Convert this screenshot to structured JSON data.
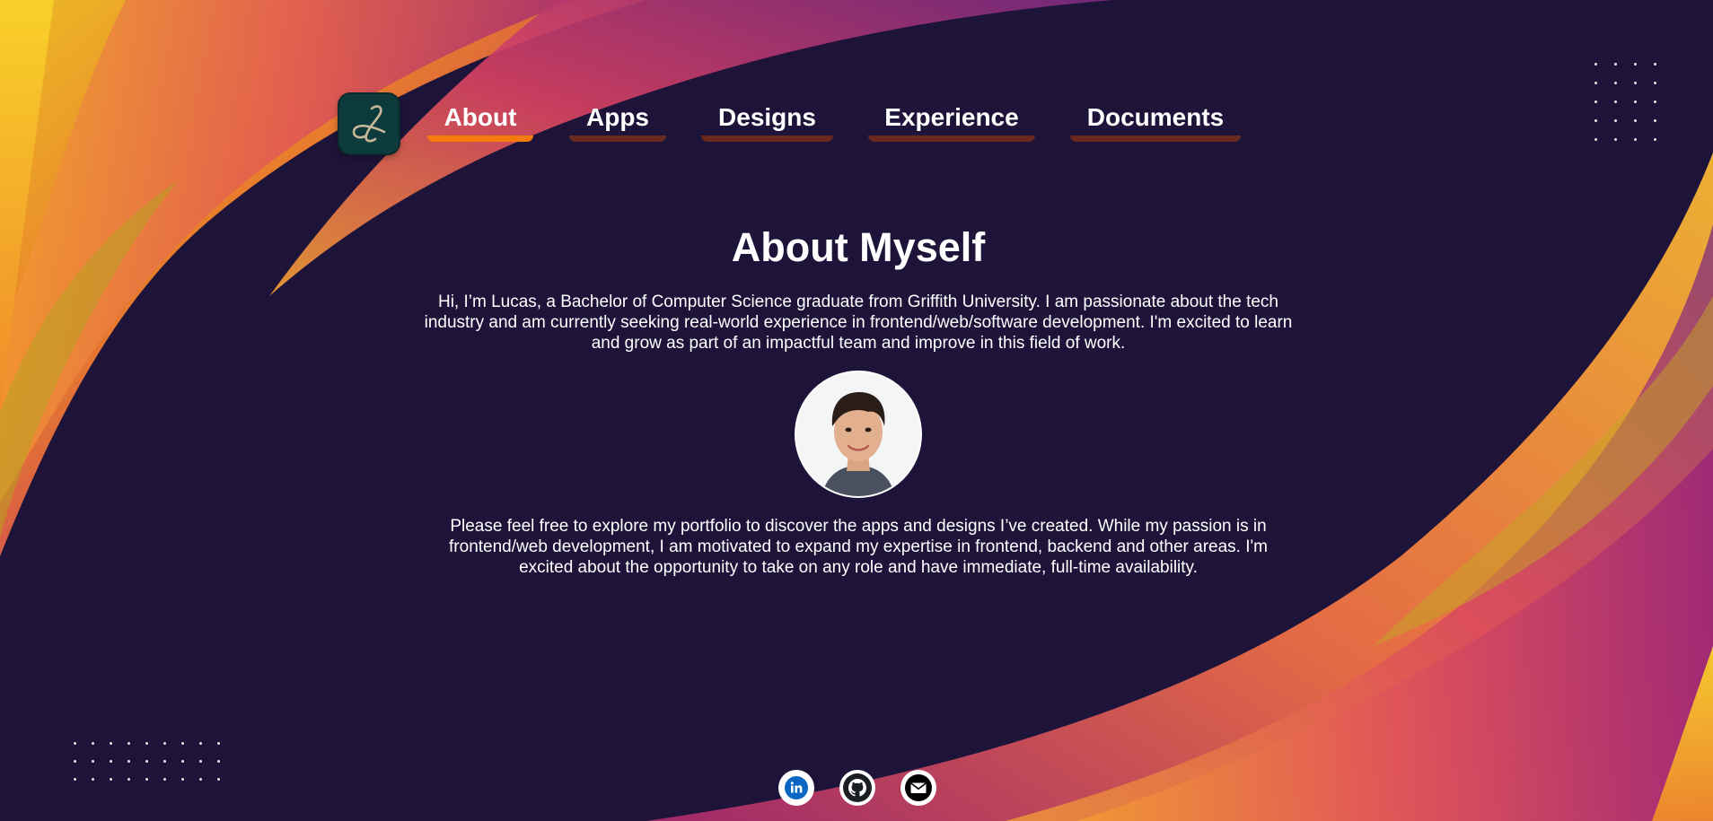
{
  "logo": {
    "alt": "Lucas logo",
    "mark": "L"
  },
  "nav": {
    "items": [
      {
        "label": "About",
        "active": true
      },
      {
        "label": "Apps",
        "active": false
      },
      {
        "label": "Designs",
        "active": false
      },
      {
        "label": "Experience",
        "active": false
      },
      {
        "label": "Documents",
        "active": false
      }
    ]
  },
  "about": {
    "title": "About Myself",
    "intro": "Hi, I’m Lucas, a Bachelor of Computer Science graduate from Griffith University. I am passionate about the tech industry and am currently seeking real-world experience in frontend/web/software development. I'm excited to learn and grow as part of an impactful team and improve in this field of work.",
    "outro": "Please feel free to explore my portfolio to discover the apps and designs I’ve created. While my passion is in frontend/web development, I am motivated to expand my expertise in frontend, backend and other areas. I'm excited about the opportunity to take on any role and have immediate, full-time availability."
  },
  "socials": [
    {
      "icon": "linkedin-icon",
      "color": "#0a66c2"
    },
    {
      "icon": "github-icon",
      "color": "#1b1f23"
    },
    {
      "icon": "email-icon",
      "color": "#000000"
    }
  ],
  "colors": {
    "background": "#1e1439",
    "accent": "#f57c0c",
    "nav_underline_inactive": "#6a2a1f",
    "logo_bg": "#0d3b3d"
  }
}
